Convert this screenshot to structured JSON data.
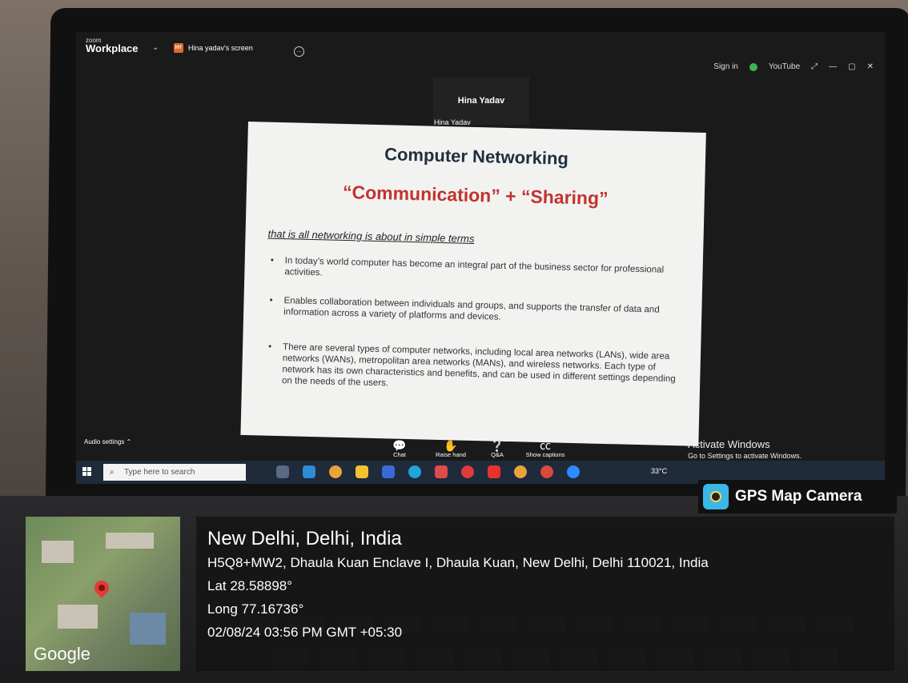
{
  "zoom": {
    "brand_small": "zoom",
    "brand_big": "Workplace",
    "share_badge": "HY",
    "share_label": "Hina yadav's screen",
    "sign_in": "Sign in",
    "youtube": "YouTube",
    "speaker_name_top": "Hina Yadav",
    "speaker_name_label": "Hina Yadav",
    "audio_settings": "Audio settings",
    "controls": [
      {
        "label": "Chat",
        "icon": "chat-icon"
      },
      {
        "label": "Raise hand",
        "icon": "hand-icon"
      },
      {
        "label": "Q&A",
        "icon": "qa-icon"
      },
      {
        "label": "Show captions",
        "icon": "cc-icon"
      }
    ]
  },
  "slide": {
    "title": "Computer Networking",
    "subtitle": "“Communication” + “Sharing”",
    "tagline": "that is all networking is about in simple terms",
    "bullets": [
      "In today’s world computer has become an integral part of the business sector for professional activities.",
      "Enables collaboration between individuals and groups, and supports the transfer of data and information across a variety of platforms and devices.",
      "There are several types of computer networks, including local area networks (LANs), wide area networks (WANs), metropolitan area networks (MANs), and wireless networks. Each type of network has its own characteristics and benefits, and can be used in different settings depending on the needs of the users."
    ]
  },
  "windows": {
    "activate_title": "Activate Windows",
    "activate_sub": "Go to Settings to activate Windows.",
    "search_placeholder": "Type here to search",
    "temperature": "33°C"
  },
  "gps": {
    "badge_label": "GPS Map Camera",
    "map_brand": "Google",
    "city": "New Delhi, Delhi, India",
    "address": "H5Q8+MW2, Dhaula Kuan Enclave I, Dhaula Kuan, New Delhi, Delhi 110021, India",
    "lat": "Lat 28.58898°",
    "long": "Long 77.16736°",
    "datetime": "02/08/24 03:56 PM GMT +05:30"
  },
  "colors": {
    "slide_title": "#1f2f3f",
    "slide_subtitle": "#c2332f",
    "taskbar": "#1f2a3a"
  }
}
